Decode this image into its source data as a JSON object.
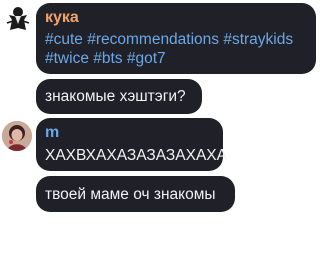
{
  "messages": [
    {
      "sender": "кука",
      "sender_color": "#f0a36a",
      "hashtags_line1": "#cute #recommendations #straykids",
      "hashtags_line2": "#twice #bts #got7",
      "hashtag_color": "#6aa8e6"
    },
    {
      "text": "знакомые хэштэги?"
    },
    {
      "sender": "m",
      "sender_color": "#6aa8e6",
      "text": "ХАХВХАХАЗАЗАЗАХАХА"
    },
    {
      "text": "твоей маме оч знакомы"
    }
  ],
  "colors": {
    "bubble": "#202028",
    "text": "#f2f2f4",
    "background": "#ffffff"
  }
}
